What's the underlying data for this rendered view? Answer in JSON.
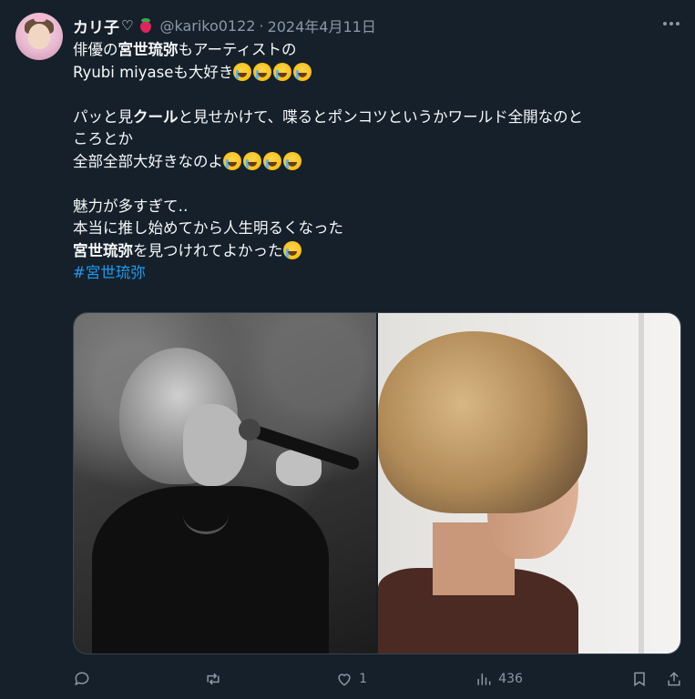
{
  "author": {
    "name": "カリ子",
    "handle": "@kariko0122",
    "separator": "·",
    "date": "2024年4月11日"
  },
  "tweet": {
    "line1_pre": "俳優の",
    "line1_bold": "宮世琉弥",
    "line1_post": "もアーティストの",
    "line2": "Ryubi miyaseも大好き",
    "line3_pre": "パッと見",
    "line3_bold": "クール",
    "line3_post": "と見せかけて、喋るとポンコツというかワールド全開なのと",
    "line4": "ころとか",
    "line5": "全部全部大好きなのよ",
    "line6": "魅力が多すぎて‥",
    "line7": "本当に推し始めてから人生明るくなった",
    "line8_bold": "宮世琉弥",
    "line8_post": "を見つけれてよかった",
    "hashtag": "#宮世琉弥"
  },
  "stats": {
    "replies": "",
    "retweets": "",
    "likes": "1",
    "views": "436"
  },
  "icons": [
    "more-icon",
    "reply-icon",
    "retweet-icon",
    "like-icon",
    "views-icon",
    "bookmark-icon",
    "share-icon"
  ],
  "colors": {
    "background": "#15202b",
    "text": "#f7f9f9",
    "muted": "#8b98a5",
    "link": "#1d9bf0"
  }
}
